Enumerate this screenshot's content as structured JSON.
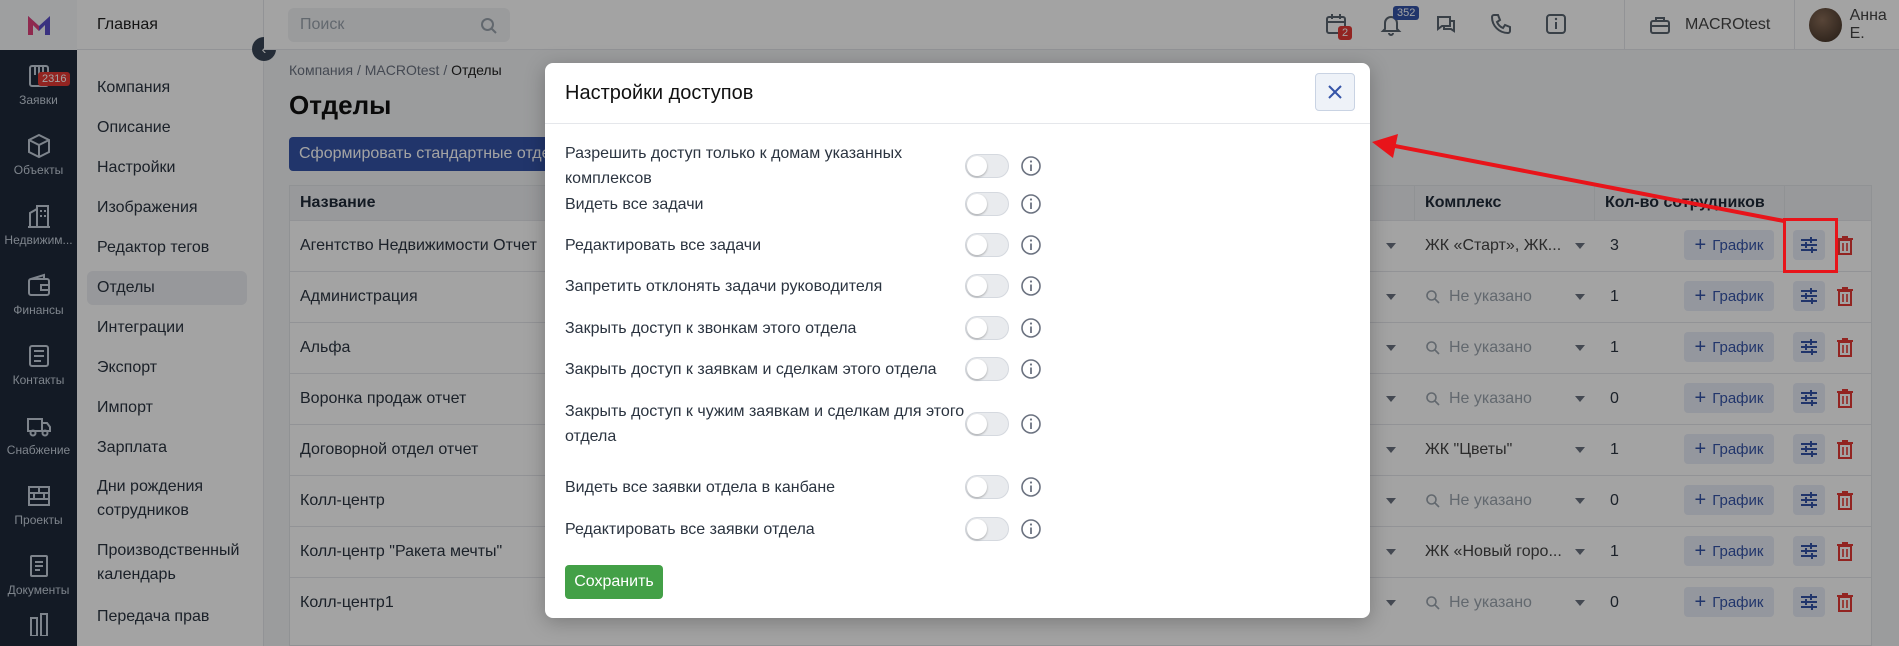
{
  "rail": {
    "badge": "2316",
    "items": [
      {
        "label": "Заявки",
        "icon": "requests-icon"
      },
      {
        "label": "Объекты",
        "icon": "cube-icon"
      },
      {
        "label": "Недвижим...",
        "icon": "building-icon"
      },
      {
        "label": "Финансы",
        "icon": "wallet-icon"
      },
      {
        "label": "Контакты",
        "icon": "contacts-icon"
      },
      {
        "label": "Снабжение",
        "icon": "truck-icon"
      },
      {
        "label": "Проекты",
        "icon": "bricks-icon"
      },
      {
        "label": "Документы",
        "icon": "document-icon"
      }
    ]
  },
  "sidemenu": {
    "title": "Главная",
    "items": [
      "Компания",
      "Описание",
      "Настройки",
      "Изображения",
      "Редактор тегов",
      "Отделы",
      "Интеграции",
      "Экспорт",
      "Импорт",
      "Зарплата",
      "Дни рождения сотрудников",
      "Производственный календарь",
      "Передача прав"
    ],
    "active": "Отделы"
  },
  "topbar": {
    "search_placeholder": "Поиск",
    "calendar_badge": "2",
    "bell_badge": "352",
    "company": "MACROtest",
    "user": "Анна Е."
  },
  "breadcrumbs": {
    "items": [
      "Компания",
      "MACROtest"
    ],
    "current": "Отделы"
  },
  "page_title": "Отделы",
  "generate_button": "Сформировать стандартные отделы",
  "table": {
    "headers": {
      "name": "Название",
      "complex": "Комплекс",
      "count": "Кол-во сотрудников"
    },
    "placeholder": "Не указано",
    "graph_label": "График",
    "rows": [
      {
        "name": "Агентство Недвижимости Отчет",
        "complex": "ЖК «Старт», ЖК...",
        "count": "3"
      },
      {
        "name": "Администрация",
        "complex": "",
        "count": "1"
      },
      {
        "name": "Альфа",
        "complex": "",
        "count": "1"
      },
      {
        "name": "Воронка продаж отчет",
        "complex": "",
        "count": "0"
      },
      {
        "name": "Договорной отдел отчет",
        "complex": "ЖК \"Цветы\"",
        "count": "1"
      },
      {
        "name": "Колл-центр",
        "complex": "",
        "count": "0"
      },
      {
        "name": "Колл-центр \"Ракета мечты\"",
        "complex": "ЖК «Новый горо...",
        "count": "1"
      },
      {
        "name": "Колл-центр1",
        "complex": "",
        "count": "0"
      }
    ]
  },
  "modal": {
    "title": "Настройки доступов",
    "options": [
      {
        "label": "Разрешить доступ только к домам указанных комплексов",
        "enabled": false
      },
      {
        "label": "Видеть все задачи",
        "enabled": false
      },
      {
        "label": "Редактировать все задачи",
        "enabled": false
      },
      {
        "label": "Запретить отклонять задачи руководителя",
        "enabled": false
      },
      {
        "label": "Закрыть доступ к звонкам этого отдела",
        "enabled": false
      },
      {
        "label": "Закрыть доступ к заявкам и сделкам этого отдела",
        "enabled": false
      },
      {
        "label": "Закрыть доступ к чужим заявкам и сделкам для этого отдела",
        "enabled": false
      },
      {
        "label": "Видеть все заявки отдела в канбане",
        "enabled": false
      },
      {
        "label": "Редактировать все заявки отдела",
        "enabled": false
      }
    ],
    "save_label": "Сохранить"
  },
  "colors": {
    "accent": "#3554a8",
    "save": "#43a047",
    "delete": "#e53935",
    "annotation": "#e8141a"
  }
}
